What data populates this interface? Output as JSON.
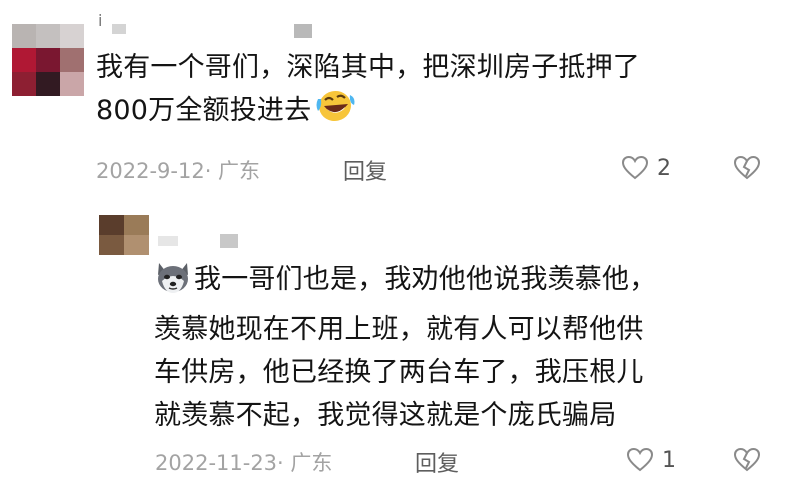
{
  "comment": {
    "text_line1": "我有一个哥们，深陷其中，把深圳房子抵押了",
    "text_line2": "800万全额投进去",
    "emoji": "laughing-crying-emoji",
    "date": "2022-9-12",
    "location": "广东",
    "reply_label": "回复",
    "like_count": "2",
    "username_visible": "i"
  },
  "reply": {
    "emoji": "husky-dog-emoji",
    "text_line1": "我一哥们也是，我劝他他说我羡慕他，",
    "text_line2": "羡慕她现在不用上班，就有人可以帮他供",
    "text_line3": "车供房，他已经换了两台车了，我压根儿",
    "text_line4": "就羡慕不起，我觉得这就是个庞氏骗局",
    "date": "2022-11-23",
    "location": "广东",
    "reply_label": "回复",
    "like_count": "1"
  },
  "colors": {
    "text": "#141414",
    "meta": "#a3a3a3",
    "reply": "#5e5e5e",
    "icon": "#8a8a8a"
  }
}
